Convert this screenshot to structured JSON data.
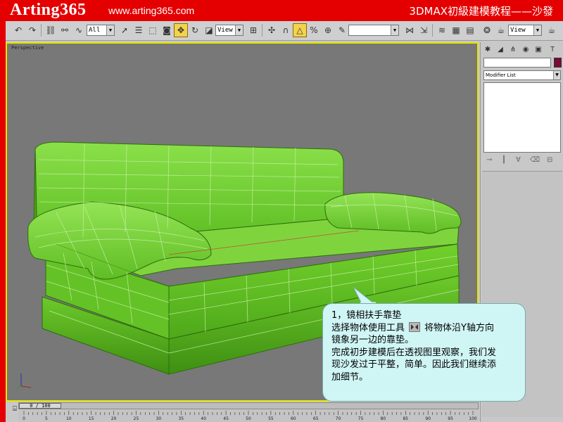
{
  "banner": {
    "brand": "Arting365",
    "site": "www.arting365.com",
    "lesson_title": "3DMAX初級建模教程——沙發"
  },
  "toolbar": {
    "selection_filter": "All",
    "ref_coord": "View",
    "ref_coord_right": "View",
    "named_selection": ""
  },
  "viewport": {
    "label": "Perspective"
  },
  "command_panel": {
    "modifier_list": "Modifier List"
  },
  "time_slider": {
    "position": "0 / 100",
    "ticks": [
      "0",
      "5",
      "10",
      "15",
      "20",
      "25",
      "30",
      "35",
      "40",
      "45",
      "50",
      "55",
      "60",
      "65",
      "70",
      "75",
      "80",
      "85",
      "90",
      "95",
      "100"
    ]
  },
  "callout": {
    "line1": "1，镜相扶手靠垫",
    "line2a": "选择物体使用工具",
    "line2b": "将物体沿Y轴方向",
    "line3": "镜象另一边的靠垫。",
    "line4": "完成初步建模后在透视图里观察，我们发",
    "line5": "现沙发过于平整，简单。因此我们继续添",
    "line6": "加细节。"
  },
  "colors": {
    "background": "#e40000",
    "viewport_border": "#e6e600",
    "sofa": "#6ed12a",
    "callout": "#d0f5f5"
  }
}
